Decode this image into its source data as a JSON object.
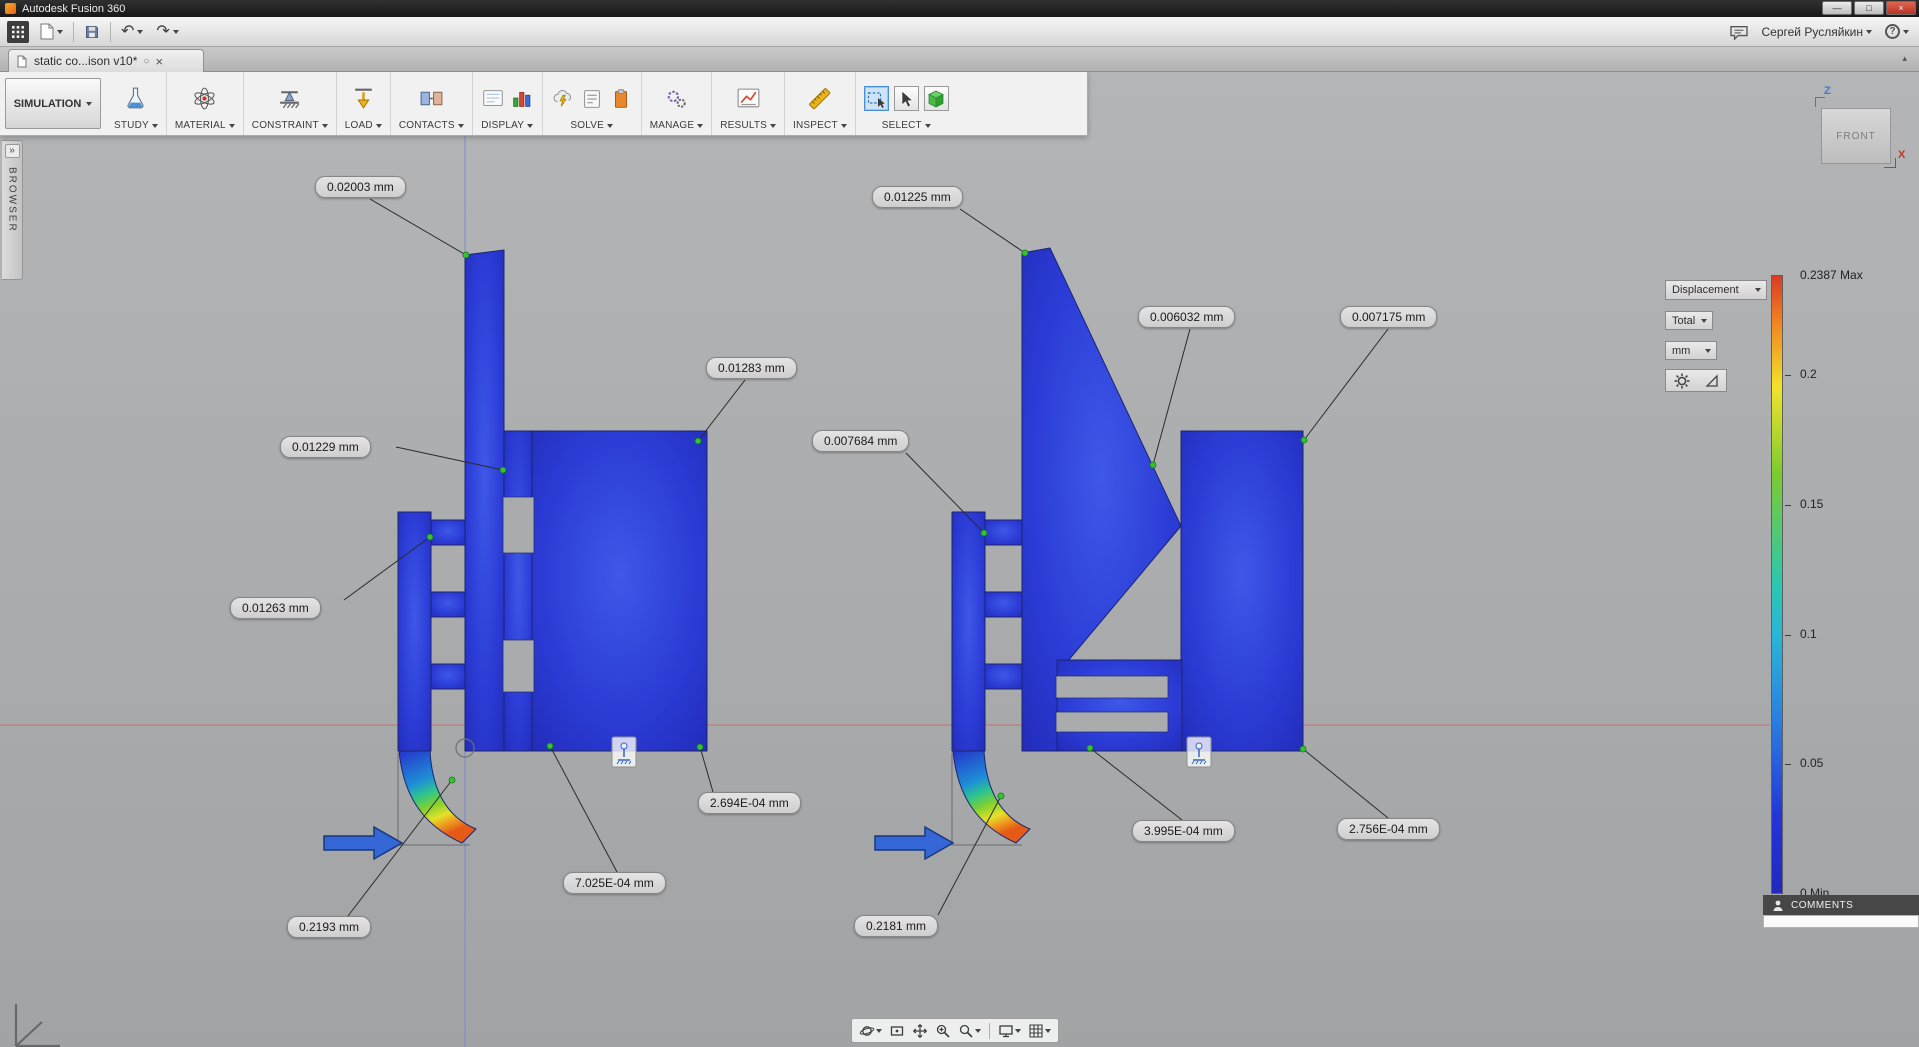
{
  "window": {
    "title": "Autodesk Fusion 360"
  },
  "icons": {
    "minimize": "—",
    "maximize": "□",
    "close": "×",
    "undo": "↶",
    "redo": "↷",
    "help": "?",
    "expand_browser": "»",
    "collapse_toolbar": "▴",
    "tab_status": "○",
    "tab_close": "×"
  },
  "menubar": {
    "user": "Сергей Русляйкин"
  },
  "tabbar": {
    "tab_label": "static co...ison v10*"
  },
  "ribbon": {
    "workspace_label": "SIMULATION",
    "groups": [
      {
        "label": "STUDY"
      },
      {
        "label": "MATERIAL"
      },
      {
        "label": "CONSTRAINT"
      },
      {
        "label": "LOAD"
      },
      {
        "label": "CONTACTS"
      },
      {
        "label": "DISPLAY"
      },
      {
        "label": "SOLVE"
      },
      {
        "label": "MANAGE"
      },
      {
        "label": "RESULTS"
      },
      {
        "label": "INSPECT"
      },
      {
        "label": "SELECT"
      }
    ]
  },
  "browser_panel": {
    "label": "BROWSER"
  },
  "viewcube": {
    "face_label": "FRONT",
    "axis_up": "Z",
    "axis_right": "X"
  },
  "annotations": {
    "left_model": [
      "0.02003 mm",
      "0.01283 mm",
      "0.01229 mm",
      "0.01263 mm",
      "2.694E-04 mm",
      "7.025E-04 mm",
      "0.2193 mm"
    ],
    "right_model": [
      "0.01225 mm",
      "0.006032 mm",
      "0.007175 mm",
      "0.007684 mm",
      "3.995E-04 mm",
      "2.756E-04 mm",
      "0.2181 mm"
    ]
  },
  "legend": {
    "title": "Displacement",
    "component": "Total",
    "unit": "mm",
    "max_label": "0.2387 Max",
    "ticks": [
      "0.2",
      "0.15",
      "0.1",
      "0.05"
    ],
    "min_label": "0 Min",
    "scale_colors": [
      "#d93a23",
      "#f07f20",
      "#f2e32b",
      "#7ccb2e",
      "#2bc7b0",
      "#2a9fe0",
      "#2434d6"
    ],
    "model_color": "#2b3cd6"
  },
  "comments": {
    "label": "COMMENTS"
  }
}
